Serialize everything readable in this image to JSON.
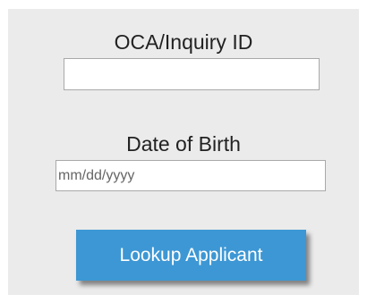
{
  "form": {
    "oca_label": "OCA/Inquiry ID",
    "oca_value": "",
    "dob_label": "Date of Birth",
    "dob_placeholder": "mm/dd/yyyy",
    "dob_value": "",
    "submit_label": "Lookup Applicant"
  },
  "colors": {
    "panel_bg": "#ebebeb",
    "button_bg": "#3d97d4",
    "button_text": "#ffffff",
    "label_text": "#222222"
  }
}
